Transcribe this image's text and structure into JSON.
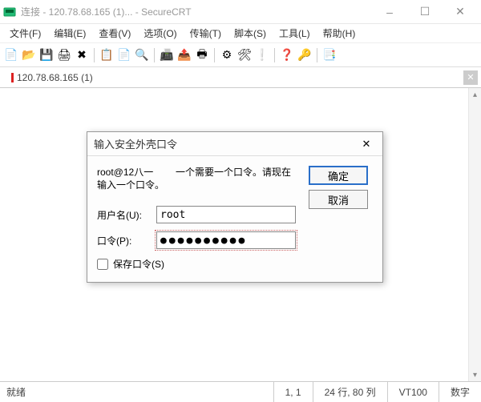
{
  "window": {
    "title": "连接 - 120.78.68.165 (1)... - SecureCRT",
    "min_tip": "–",
    "max_tip": "☐",
    "close_tip": "✕"
  },
  "menu": {
    "file": "文件(F)",
    "edit": "编辑(E)",
    "view": "查看(V)",
    "options": "选项(O)",
    "transfer": "传输(T)",
    "script": "脚本(S)",
    "tools": "工具(L)",
    "help": "帮助(H)"
  },
  "tab": {
    "label": "120.78.68.165 (1)"
  },
  "dialog": {
    "title": "输入安全外壳口令",
    "msg_left_1": "root@12八一",
    "msg_left_2": "输入一个口令。",
    "msg_right": "一个需要一个口令。请现在",
    "username_label": "用户名(U):",
    "username_value": "root",
    "password_label": "口令(P):",
    "password_value": "●●●●●●●●●●",
    "save_label": "保存口令(S)",
    "ok": "确定",
    "cancel": "取消",
    "close_x": "✕"
  },
  "status": {
    "ready": "就绪",
    "cursor": "1,  1",
    "size": "24 行, 80 列",
    "term": "VT100",
    "numlock": "数字"
  },
  "icons": {
    "i1": "📄",
    "i2": "📂",
    "i3": "💾",
    "i4": "🖨",
    "i5": "✖",
    "i6": "📋",
    "i7": "📄",
    "i8": "🔍",
    "i9": "📠",
    "i10": "📤",
    "i11": "🖶",
    "i12": "⚙",
    "i13": "🛠",
    "i14": "❕",
    "i15": "❓",
    "i16": "🔑",
    "i17": "📑"
  }
}
